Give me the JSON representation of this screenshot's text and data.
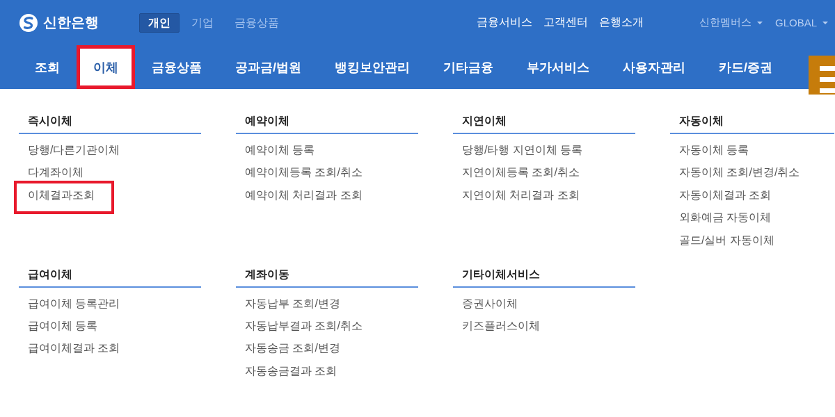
{
  "header": {
    "logo": "신한은행",
    "tabs": [
      {
        "label": "개인",
        "selected": true
      },
      {
        "label": "기업",
        "selected": false
      },
      {
        "label": "금융상품",
        "selected": false
      }
    ],
    "links": [
      "금융서비스",
      "고객센터",
      "은행소개"
    ],
    "dropdowns": [
      "신한멤버스",
      "GLOBAL"
    ]
  },
  "nav": [
    {
      "label": "조회",
      "selected": false,
      "highlighted": false
    },
    {
      "label": "이체",
      "selected": true,
      "highlighted": true
    },
    {
      "label": "금융상품",
      "selected": false,
      "highlighted": false
    },
    {
      "label": "공과금/법원",
      "selected": false,
      "highlighted": false
    },
    {
      "label": "뱅킹보안관리",
      "selected": false,
      "highlighted": false
    },
    {
      "label": "기타금융",
      "selected": false,
      "highlighted": false
    },
    {
      "label": "부가서비스",
      "selected": false,
      "highlighted": false
    },
    {
      "label": "사용자관리",
      "selected": false,
      "highlighted": false
    },
    {
      "label": "카드/증권",
      "selected": false,
      "highlighted": false
    }
  ],
  "menu_groups": [
    {
      "title": "즉시이체",
      "items": [
        {
          "label": "당행/다른기관이체",
          "highlighted": false
        },
        {
          "label": "다계좌이체",
          "highlighted": false
        },
        {
          "label": "이체결과조회",
          "highlighted": true
        }
      ]
    },
    {
      "title": "예약이체",
      "items": [
        {
          "label": "예약이체 등록",
          "highlighted": false
        },
        {
          "label": "예약이체등록 조회/취소",
          "highlighted": false
        },
        {
          "label": "예약이체 처리결과 조회",
          "highlighted": false
        }
      ]
    },
    {
      "title": "지연이체",
      "items": [
        {
          "label": "당행/타행 지연이체 등록",
          "highlighted": false
        },
        {
          "label": "지연이체등록 조회/취소",
          "highlighted": false
        },
        {
          "label": "지연이체 처리결과 조회",
          "highlighted": false
        }
      ]
    },
    {
      "title": "자동이체",
      "items": [
        {
          "label": "자동이체 등록",
          "highlighted": false
        },
        {
          "label": "자동이체 조회/변경/취소",
          "highlighted": false
        },
        {
          "label": "자동이체결과 조회",
          "highlighted": false
        },
        {
          "label": "외화예금 자동이체",
          "highlighted": false
        },
        {
          "label": "골드/실버 자동이체",
          "highlighted": false
        }
      ]
    },
    {
      "title": "급여이체",
      "items": [
        {
          "label": "급여이체 등록관리",
          "highlighted": false
        },
        {
          "label": "급여이체 등록",
          "highlighted": false
        },
        {
          "label": "급여이체결과 조회",
          "highlighted": false
        }
      ]
    },
    {
      "title": "계좌이동",
      "items": [
        {
          "label": "자동납부 조회/변경",
          "highlighted": false
        },
        {
          "label": "자동납부결과 조회/취소",
          "highlighted": false
        },
        {
          "label": "자동송금 조회/변경",
          "highlighted": false
        },
        {
          "label": "자동송금결과 조회",
          "highlighted": false
        }
      ]
    },
    {
      "title": "기타이체서비스",
      "items": [
        {
          "label": "증권사이체",
          "highlighted": false
        },
        {
          "label": "키즈플러스이체",
          "highlighted": false
        }
      ]
    }
  ]
}
